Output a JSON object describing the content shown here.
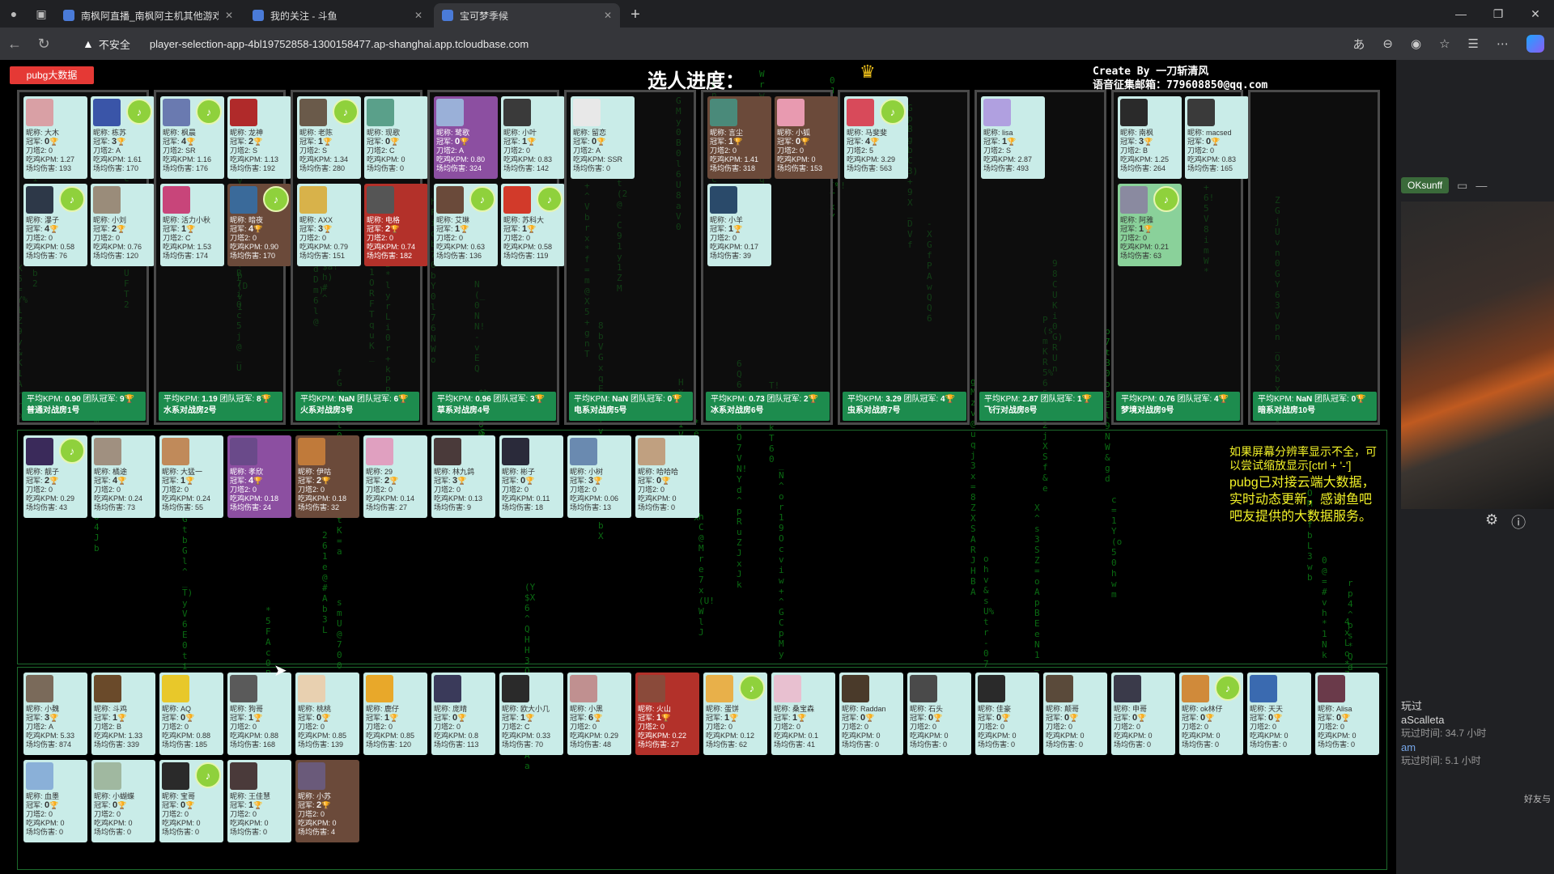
{
  "browser": {
    "tabs": [
      {
        "title": "南枫阿直播_南枫阿主机其他游戏",
        "active": false
      },
      {
        "title": "我的关注 - 斗鱼",
        "active": false
      },
      {
        "title": "宝可梦季候",
        "active": true
      }
    ],
    "new_tab": "+",
    "not_secure": "不安全",
    "url": "player-selection-app-4bl19752858-1300158477.ap-shanghai.app.tcloudbase.com"
  },
  "page": {
    "pubg_button": "pubg大数据",
    "title": "选人进度：",
    "credit_line1": "Create By 一刀斩清风",
    "credit_line2": "语音征集邮箱：779608850@qq.com",
    "notice_small": "如果屏幕分辨率显示不全，可以尝试缩放显示[ctrl + '-']",
    "notice_main": "pubg已对接云端大数据，实时动态更新，感谢鱼吧吧友提供的大数据服务。"
  },
  "labels": {
    "name": "昵称: ",
    "champ": "冠军: ",
    "kd": "刀塔2: ",
    "kpm": "吃鸡KPM: ",
    "dmg": "场均伤害: ",
    "avg_kpm": "平均KPM: ",
    "team_champ": "团队冠军: "
  },
  "rooms": [
    {
      "name": "普通对战房1号",
      "avg_kpm": "0.90",
      "champs": "9",
      "members": [
        {
          "name": "大木",
          "champ": "0",
          "kd": "0",
          "kpm": "1.27",
          "dmg": "193",
          "color": "#d9a0a5"
        },
        {
          "name": "栋苏",
          "champ": "3",
          "kd": "A",
          "kpm": "1.61",
          "dmg": "170",
          "color": "#3a55a8",
          "speaker": true
        },
        {
          "name": "瀑子",
          "champ": "4",
          "kd": "0",
          "kpm": "0.58",
          "dmg": "76",
          "color": "#2d3848",
          "speaker": true
        },
        {
          "name": "小刘",
          "champ": "2",
          "kd": "0",
          "kpm": "0.76",
          "dmg": "120",
          "color": "#9a8c7a"
        }
      ]
    },
    {
      "name": "水系对战房2号",
      "avg_kpm": "1.19",
      "champs": "8",
      "members": [
        {
          "name": "枫晨",
          "champ": "4",
          "kd": "SR",
          "kpm": "1.16",
          "dmg": "176",
          "color": "#6a7ab0",
          "speaker": true
        },
        {
          "name": "龙神",
          "champ": "2",
          "kd": "S",
          "kpm": "1.13",
          "dmg": "192",
          "color": "#b02a2a"
        },
        {
          "name": "活力小秋",
          "champ": "1",
          "kd": "C",
          "kpm": "1.53",
          "dmg": "174",
          "color": "#c8457a"
        },
        {
          "name": "暗夜",
          "champ": "4",
          "kd": "0",
          "kpm": "0.90",
          "dmg": "170",
          "color": "#3a6a9a",
          "speaker": true,
          "style": "dark"
        }
      ]
    },
    {
      "name": "火系对战房3号",
      "avg_kpm": "NaN",
      "champs": "6",
      "members": [
        {
          "name": "老陈",
          "champ": "1",
          "kd": "S",
          "kpm": "1.34",
          "dmg": "280",
          "color": "#6a5a4a",
          "speaker": true
        },
        {
          "name": "现歌",
          "champ": "0",
          "kd": "C",
          "kpm": "0",
          "dmg": "0",
          "color": "#5aa08a"
        },
        {
          "name": "AXX",
          "champ": "3",
          "kd": "0",
          "kpm": "0.79",
          "dmg": "151",
          "color": "#d8b24a"
        },
        {
          "name": "电格",
          "champ": "2",
          "kd": "0",
          "kpm": "0.74",
          "dmg": "182",
          "color": "#555",
          "style": "red"
        }
      ]
    },
    {
      "name": "草系对战房4号",
      "avg_kpm": "0.96",
      "champs": "3",
      "members": [
        {
          "name": "鹭歌",
          "champ": "0",
          "kd": "A",
          "kpm": "0.80",
          "dmg": "324",
          "color": "#9ab0d8",
          "style": "purple"
        },
        {
          "name": "小叶",
          "champ": "1",
          "kd": "0",
          "kpm": "0.83",
          "dmg": "142",
          "color": "#3a3a3a"
        },
        {
          "name": "艾琳",
          "champ": "1",
          "kd": "0",
          "kpm": "0.63",
          "dmg": "136",
          "color": "#6a4a3a",
          "speaker": true
        },
        {
          "name": "苏科大",
          "champ": "1",
          "kd": "0",
          "kpm": "0.58",
          "dmg": "119",
          "color": "#d23a2a",
          "speaker": true
        }
      ]
    },
    {
      "name": "电系对战房5号",
      "avg_kpm": "NaN",
      "champs": "0",
      "members": [
        {
          "name": "留恋",
          "champ": "0",
          "kd": "A",
          "kpm": "SSR",
          "dmg": "0",
          "color": "#e8e8e8"
        }
      ]
    },
    {
      "name": "冰系对战房6号",
      "avg_kpm": "0.73",
      "champs": "2",
      "members": [
        {
          "name": "言尘",
          "champ": "1",
          "kd": "0",
          "kpm": "1.41",
          "dmg": "318",
          "color": "#4a8a7a",
          "style": "dark"
        },
        {
          "name": "小狐",
          "champ": "0",
          "kd": "0",
          "kpm": "0",
          "dmg": "153",
          "color": "#e89ab0",
          "style": "dark"
        },
        {
          "name": "小羊",
          "champ": "1",
          "kd": "0",
          "kpm": "0.17",
          "dmg": "39",
          "color": "#2a4a6a"
        }
      ]
    },
    {
      "name": "虫系对战房7号",
      "avg_kpm": "3.29",
      "champs": "4",
      "members": [
        {
          "name": "马斐斐",
          "champ": "4",
          "kd": "5",
          "kpm": "3.29",
          "dmg": "563",
          "color": "#d84a5a",
          "speaker": true
        }
      ]
    },
    {
      "name": "飞行对战房8号",
      "avg_kpm": "2.87",
      "champs": "1",
      "members": [
        {
          "name": "lisa",
          "champ": "1",
          "kd": "S",
          "kpm": "2.87",
          "dmg": "493",
          "color": "#b0a0e0"
        }
      ]
    },
    {
      "name": "梦境对战房9号",
      "avg_kpm": "0.76",
      "champs": "4",
      "members": [
        {
          "name": "南枫",
          "champ": "3",
          "kd": "B",
          "kpm": "1.25",
          "dmg": "264",
          "color": "#2a2a2a"
        },
        {
          "name": "macsed",
          "champ": "0",
          "kd": "0",
          "kpm": "0.83",
          "dmg": "165",
          "color": "#3a3a3a"
        },
        {
          "name": "阿雅",
          "champ": "1",
          "kd": "0",
          "kpm": "0.21",
          "dmg": "63",
          "color": "#8a8aa0",
          "speaker": true,
          "style": "green"
        }
      ]
    },
    {
      "name": "暗系对战房10号",
      "avg_kpm": "NaN",
      "champs": "0",
      "members": []
    }
  ],
  "waiting": [
    {
      "name": "靓子",
      "champ": "2",
      "kd": "0",
      "kpm": "0.29",
      "dmg": "43",
      "color": "#3a2a5a",
      "speaker": true
    },
    {
      "name": "橘途",
      "champ": "4",
      "kd": "0",
      "kpm": "0.24",
      "dmg": "73",
      "color": "#a09080"
    },
    {
      "name": "大猛一",
      "champ": "1",
      "kd": "0",
      "kpm": "0.24",
      "dmg": "55",
      "color": "#c08a5a"
    },
    {
      "name": "孝欣",
      "champ": "4",
      "kd": "0",
      "kpm": "0.18",
      "dmg": "24",
      "color": "#6a4a8a",
      "style": "purple"
    },
    {
      "name": "伊咕",
      "champ": "2",
      "kd": "0",
      "kpm": "0.18",
      "dmg": "32",
      "color": "#c07a3a",
      "style": "dark"
    },
    {
      "name": "29",
      "champ": "2",
      "kd": "0",
      "kpm": "0.14",
      "dmg": "27",
      "color": "#e0a0c0"
    },
    {
      "name": "林九鸽",
      "champ": "3",
      "kd": "0",
      "kpm": "0.13",
      "dmg": "9",
      "color": "#4a3a3a"
    },
    {
      "name": "彬子",
      "champ": "0",
      "kd": "0",
      "kpm": "0.11",
      "dmg": "18",
      "color": "#2a2a3a"
    },
    {
      "name": "小树",
      "champ": "3",
      "kd": "0",
      "kpm": "0.06",
      "dmg": "13",
      "color": "#6a8ab0"
    },
    {
      "name": "哈哈哈",
      "champ": "0",
      "kd": "0",
      "kpm": "0",
      "dmg": "0",
      "color": "#c0a080"
    }
  ],
  "pool": [
    {
      "name": "小魏",
      "champ": "3",
      "kd": "A",
      "kpm": "5.33",
      "dmg": "874",
      "color": "#7a6a5a"
    },
    {
      "name": "斗鸡",
      "champ": "1",
      "kd": "B",
      "kpm": "1.33",
      "dmg": "339",
      "color": "#6a4a2a"
    },
    {
      "name": "AQ",
      "champ": "0",
      "kd": "0",
      "kpm": "0.88",
      "dmg": "185",
      "color": "#e8c82a"
    },
    {
      "name": "狗哥",
      "champ": "1",
      "kd": "0",
      "kpm": "0.88",
      "dmg": "168",
      "color": "#5a5a5a"
    },
    {
      "name": "桃桃",
      "champ": "0",
      "kd": "0",
      "kpm": "0.85",
      "dmg": "139",
      "color": "#e8d0b0"
    },
    {
      "name": "鹿仔",
      "champ": "1",
      "kd": "0",
      "kpm": "0.85",
      "dmg": "120",
      "color": "#e8a82a"
    },
    {
      "name": "庞晴",
      "champ": "0",
      "kd": "0",
      "kpm": "0.8",
      "dmg": "113",
      "color": "#3a3a5a"
    },
    {
      "name": "欧大小几",
      "champ": "1",
      "kd": "C",
      "kpm": "0.33",
      "dmg": "70",
      "color": "#2a2a2a"
    },
    {
      "name": "小黑",
      "champ": "6",
      "kd": "0",
      "kpm": "0.29",
      "dmg": "48",
      "color": "#c09090"
    },
    {
      "name": "火山",
      "champ": "1",
      "kd": "0",
      "kpm": "0.22",
      "dmg": "27",
      "color": "#8a4a3a",
      "style": "red"
    },
    {
      "name": "蛋饼",
      "champ": "1",
      "kd": "0",
      "kpm": "0.12",
      "dmg": "62",
      "color": "#e8b04a",
      "speaker": true
    },
    {
      "name": "桑宝森",
      "champ": "1",
      "kd": "0",
      "kpm": "0.1",
      "dmg": "41",
      "color": "#e8c0d0"
    },
    {
      "name": "Raddan",
      "champ": "0",
      "kd": "0",
      "kpm": "0",
      "dmg": "0",
      "color": "#4a3a2a"
    },
    {
      "name": "石头",
      "champ": "0",
      "kd": "0",
      "kpm": "0",
      "dmg": "0",
      "color": "#4a4a4a"
    },
    {
      "name": "佳豪",
      "champ": "0",
      "kd": "0",
      "kpm": "0",
      "dmg": "0",
      "color": "#2a2a2a"
    },
    {
      "name": "颠哥",
      "champ": "0",
      "kd": "0",
      "kpm": "0",
      "dmg": "0",
      "color": "#5a4a3a"
    },
    {
      "name": "申哥",
      "champ": "0",
      "kd": "0",
      "kpm": "0",
      "dmg": "0",
      "color": "#3a3a4a"
    },
    {
      "name": "ok林仔",
      "champ": "0",
      "kd": "0",
      "kpm": "0",
      "dmg": "0",
      "color": "#d08a3a",
      "speaker": true
    },
    {
      "name": "天天",
      "champ": "0",
      "kd": "0",
      "kpm": "0",
      "dmg": "0",
      "color": "#3a6ab0"
    },
    {
      "name": "Alisa",
      "champ": "0",
      "kd": "0",
      "kpm": "0",
      "dmg": "0",
      "color": "#6a3a4a"
    },
    {
      "name": "血墨",
      "champ": "0",
      "kd": "0",
      "kpm": "0",
      "dmg": "0",
      "color": "#8ab0d8"
    },
    {
      "name": "小蝴蝶",
      "champ": "0",
      "kd": "0",
      "kpm": "0",
      "dmg": "0",
      "color": "#a0b8a0"
    },
    {
      "name": "宝哥",
      "champ": "0",
      "kd": "0",
      "kpm": "0",
      "dmg": "0",
      "color": "#2a2a2a",
      "speaker": true
    },
    {
      "name": "王佳慧",
      "champ": "1",
      "kd": "0",
      "kpm": "0",
      "dmg": "0",
      "color": "#4a3a3a"
    },
    {
      "name": "小苏",
      "champ": "2",
      "kd": "0",
      "kpm": "0",
      "dmg": "4",
      "color": "#6a5a7a",
      "style": "dark"
    }
  ],
  "sidebar": {
    "user": "OKsunff",
    "game": "玩过",
    "game2": "aScalleta",
    "played": "玩过时间: 34.7 小时",
    "name2": "am",
    "played2": "玩过时间: 5.1 小时",
    "friends": "好友与"
  },
  "icons": [
    "back-arrow-icon",
    "refresh-icon",
    "warning-icon",
    "translate-icon",
    "zoom-icon",
    "star-icon",
    "more-icon",
    "close-icon",
    "speaker-icon",
    "trophy-icon",
    "crown-icon",
    "gear-icon",
    "info-icon",
    "cursor-icon"
  ],
  "colors": {
    "card": "#c9ece8",
    "footer": "#1d8c4e",
    "speaker": "#8fd13c",
    "rain": "#0a6a12",
    "notice": "#f3f328",
    "title": "#ffffff",
    "pubg": "#e53935"
  }
}
